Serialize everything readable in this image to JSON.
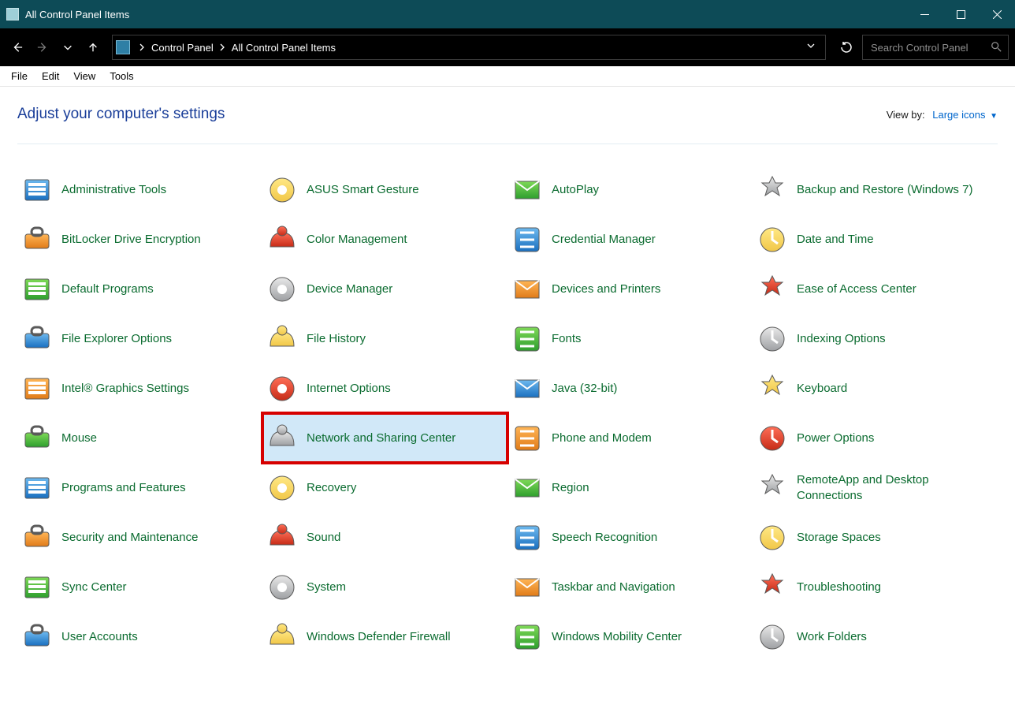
{
  "window": {
    "title": "All Control Panel Items"
  },
  "breadcrumbs": [
    "Control Panel",
    "All Control Panel Items"
  ],
  "search": {
    "placeholder": "Search Control Panel"
  },
  "menu": {
    "file": "File",
    "edit": "Edit",
    "view": "View",
    "tools": "Tools"
  },
  "header": {
    "heading": "Adjust your computer's settings",
    "viewby_label": "View by:",
    "viewby_value": "Large icons"
  },
  "items": [
    {
      "label": "Administrative Tools"
    },
    {
      "label": "ASUS Smart Gesture"
    },
    {
      "label": "AutoPlay"
    },
    {
      "label": "Backup and Restore (Windows 7)"
    },
    {
      "label": "BitLocker Drive Encryption"
    },
    {
      "label": "Color Management"
    },
    {
      "label": "Credential Manager"
    },
    {
      "label": "Date and Time"
    },
    {
      "label": "Default Programs"
    },
    {
      "label": "Device Manager"
    },
    {
      "label": "Devices and Printers"
    },
    {
      "label": "Ease of Access Center"
    },
    {
      "label": "File Explorer Options"
    },
    {
      "label": "File History"
    },
    {
      "label": "Fonts"
    },
    {
      "label": "Indexing Options"
    },
    {
      "label": "Intel® Graphics Settings"
    },
    {
      "label": "Internet Options"
    },
    {
      "label": "Java (32-bit)"
    },
    {
      "label": "Keyboard"
    },
    {
      "label": "Mouse"
    },
    {
      "label": "Network and Sharing Center",
      "highlight": true
    },
    {
      "label": "Phone and Modem"
    },
    {
      "label": "Power Options"
    },
    {
      "label": "Programs and Features"
    },
    {
      "label": "Recovery"
    },
    {
      "label": "Region"
    },
    {
      "label": "RemoteApp and Desktop Connections"
    },
    {
      "label": "Security and Maintenance"
    },
    {
      "label": "Sound"
    },
    {
      "label": "Speech Recognition"
    },
    {
      "label": "Storage Spaces"
    },
    {
      "label": "Sync Center"
    },
    {
      "label": "System"
    },
    {
      "label": "Taskbar and Navigation"
    },
    {
      "label": "Troubleshooting"
    },
    {
      "label": "User Accounts"
    },
    {
      "label": "Windows Defender Firewall"
    },
    {
      "label": "Windows Mobility Center"
    },
    {
      "label": "Work Folders"
    }
  ]
}
